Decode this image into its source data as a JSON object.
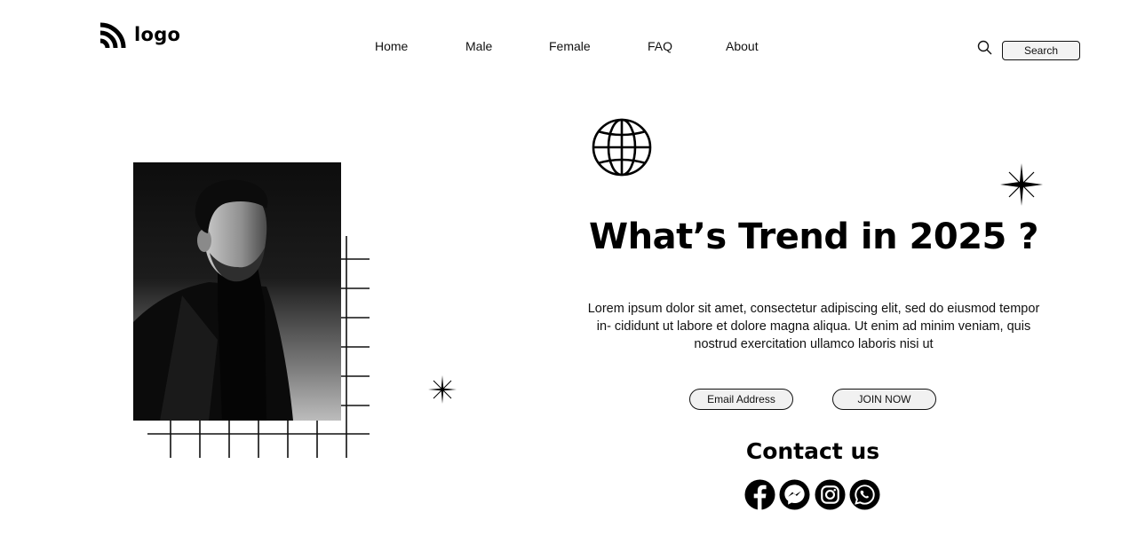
{
  "header": {
    "logo_text": "logo",
    "nav": [
      "Home",
      "Male",
      "Female",
      "FAQ",
      "About"
    ],
    "search_label": "Search"
  },
  "hero": {
    "headline": "What’s Trend in 2025 ?",
    "body": "Lorem ipsum dolor sit amet, consectetur adipiscing elit, sed do eiusmod tempor in- cididunt ut labore et dolore magna aliqua. Ut enim ad minim veniam, quis nostrud exercitation ullamco laboris nisi ut",
    "email_label": "Email Address",
    "join_label": "JOIN NOW"
  },
  "contact": {
    "title": "Contact us",
    "socials": [
      "facebook-icon",
      "messenger-icon",
      "instagram-icon",
      "whatsapp-icon"
    ]
  },
  "colors": {
    "text": "#000000",
    "button_bg": "#f1f1f1",
    "background": "#ffffff"
  }
}
